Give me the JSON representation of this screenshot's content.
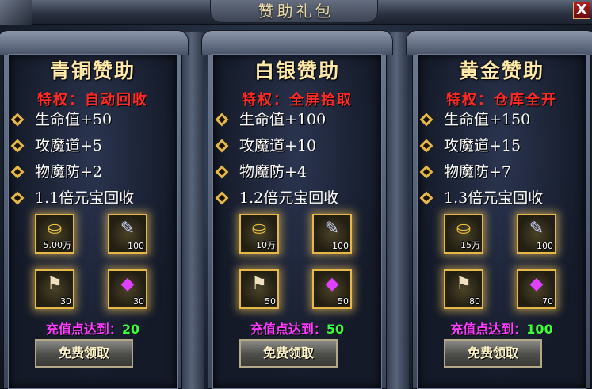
{
  "window": {
    "title": "赞助礼包",
    "close_label": "X"
  },
  "panels": [
    {
      "title": "青铜赞助",
      "privilege": "特权：自动回收",
      "stats": [
        "生命值+50",
        "攻魔道+5",
        "物魔防+2",
        "1.1倍元宝回收"
      ],
      "items": [
        {
          "icon": "gold-ingot-icon",
          "qty": "5.00万"
        },
        {
          "icon": "scroll-icon",
          "qty": "100"
        },
        {
          "icon": "flag-icon",
          "qty": "30"
        },
        {
          "icon": "crystal-icon",
          "qty": "30"
        }
      ],
      "requirement_label": "充值点达到：",
      "requirement_value": "20",
      "claim_label": "免费领取"
    },
    {
      "title": "白银赞助",
      "privilege": "特权：全屏拾取",
      "stats": [
        "生命值+100",
        "攻魔道+10",
        "物魔防+4",
        "1.2倍元宝回收"
      ],
      "items": [
        {
          "icon": "gold-ingot-icon",
          "qty": "10万"
        },
        {
          "icon": "scroll-icon",
          "qty": "100"
        },
        {
          "icon": "flag-icon",
          "qty": "50"
        },
        {
          "icon": "crystal-icon",
          "qty": "50"
        }
      ],
      "requirement_label": "充值点达到：",
      "requirement_value": "50",
      "claim_label": "免费领取"
    },
    {
      "title": "黄金赞助",
      "privilege": "特权：仓库全开",
      "stats": [
        "生命值+150",
        "攻魔道+15",
        "物魔防+7",
        "1.3倍元宝回收"
      ],
      "items": [
        {
          "icon": "gold-ingot-icon",
          "qty": "15万"
        },
        {
          "icon": "scroll-icon",
          "qty": "100"
        },
        {
          "icon": "flag-icon",
          "qty": "80"
        },
        {
          "icon": "crystal-icon",
          "qty": "70"
        }
      ],
      "requirement_label": "充值点达到：",
      "requirement_value": "100",
      "claim_label": "免费领取"
    }
  ],
  "colors": {
    "privilege": "#ff2a22",
    "requirement_label": "#ff3cff",
    "requirement_value": "#3cff3c",
    "title": "#ffe9a8"
  }
}
